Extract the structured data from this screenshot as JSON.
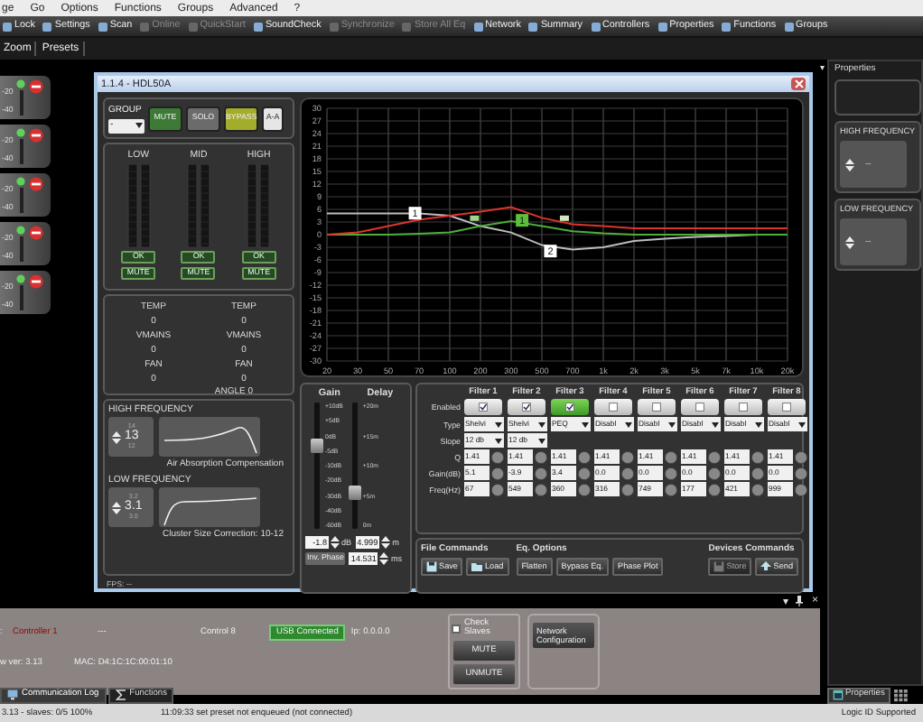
{
  "menu": [
    "ge",
    "Go",
    "Options",
    "Functions",
    "Groups",
    "Advanced",
    "?"
  ],
  "toolbar": [
    {
      "label": "Lock",
      "disabled": false
    },
    {
      "label": "Settings",
      "disabled": false
    },
    {
      "label": "Scan",
      "disabled": false
    },
    {
      "label": "Online",
      "disabled": true
    },
    {
      "label": "QuickStart",
      "disabled": true
    },
    {
      "label": "SoundCheck",
      "disabled": false
    },
    {
      "label": "Synchronize",
      "disabled": true
    },
    {
      "label": "Store All Eq",
      "disabled": true
    },
    {
      "label": "Network",
      "disabled": false
    },
    {
      "label": "Summary",
      "disabled": false
    },
    {
      "label": "Controllers",
      "disabled": false
    },
    {
      "label": "Properties",
      "disabled": false
    },
    {
      "label": "Functions",
      "disabled": false
    },
    {
      "label": "Groups",
      "disabled": false
    }
  ],
  "toolbar2": [
    "Zoom",
    "Presets"
  ],
  "devices": [
    {
      "labels": [
        "-20",
        "-40"
      ]
    },
    {
      "labels": [
        "-20",
        "-40"
      ]
    },
    {
      "labels": [
        "-20",
        "-40"
      ]
    },
    {
      "labels": [
        "-20",
        "-40"
      ]
    },
    {
      "labels": [
        "-20",
        "-40"
      ]
    }
  ],
  "window": {
    "title": "1.1.4 - HDL50A",
    "group": {
      "label": "GROUP",
      "value": "-",
      "buttons": [
        {
          "label": "MUTE",
          "color": "#3d7a36"
        },
        {
          "label": "SOLO",
          "color": "#6b6b6b"
        },
        {
          "label": "BYPASS",
          "color": "#a3ad2c"
        },
        {
          "label": "A-A",
          "color": "#e6e6e6"
        }
      ]
    },
    "bands": [
      {
        "label": "LOW",
        "status": "OK",
        "mute": "MUTE"
      },
      {
        "label": "MID",
        "status": "OK",
        "mute": "MUTE"
      },
      {
        "label": "HIGH",
        "status": "OK",
        "mute": "MUTE"
      }
    ],
    "status_columns": [
      [
        {
          "label": "TEMP",
          "value": "0"
        },
        {
          "label": "VMAINS",
          "value": "0"
        },
        {
          "label": "FAN",
          "value": "0"
        }
      ],
      [
        {
          "label": "TEMP",
          "value": "0"
        },
        {
          "label": "VMAINS",
          "value": "0"
        },
        {
          "label": "FAN",
          "value": "0"
        }
      ]
    ],
    "angle": "ANGLE 0",
    "corrections": [
      {
        "kind": "air",
        "title": "HIGH FREQUENCY",
        "above": "14",
        "value": "13",
        "below": "12",
        "caption": "Air Absorption Compensation"
      },
      {
        "kind": "cluster",
        "title": "LOW FREQUENCY",
        "above": "3.2",
        "value": "3.1",
        "below": "3.0",
        "caption": "Cluster Size Correction:  10-12"
      }
    ],
    "fps": "FPS: --",
    "graph": {
      "chart_data": {
        "type": "line",
        "categories": [
          "20",
          "30",
          "50",
          "70",
          "100",
          "200",
          "300",
          "500",
          "700",
          "1k",
          "2k",
          "3k",
          "5k",
          "7k",
          "10k",
          "20k"
        ],
        "ylim": [
          -30,
          30
        ],
        "grid": true,
        "yticks": [
          30,
          27,
          24,
          21,
          18,
          15,
          12,
          9,
          6,
          3,
          0,
          -3,
          -6,
          -9,
          -12,
          -15,
          -18,
          -21,
          -24,
          -27,
          -30
        ],
        "series": [
          {
            "color": "#bdbdbd",
            "values": [
              5,
              5,
              5,
              5,
              4.5,
              2,
              0.5,
              -2.5,
              -3.5,
              -3,
              -1.5,
              -1,
              -0.5,
              -0.3,
              0,
              0
            ]
          },
          {
            "color": "#4caf3a",
            "values": [
              0,
              0,
              0,
              0.2,
              0.5,
              2,
              3.2,
              2,
              0.8,
              0.3,
              0,
              0,
              0,
              0,
              0,
              0
            ]
          },
          {
            "color": "#e0342c",
            "values": [
              0,
              0.5,
              2,
              3.5,
              4.5,
              5.5,
              6.5,
              4,
              2.5,
              2,
              1.5,
              1.5,
              1.5,
              1.5,
              1.5,
              1.5
            ]
          }
        ],
        "annotations": [
          "1",
          "1",
          "2"
        ]
      }
    },
    "gain_delay": {
      "gain_label": "Gain",
      "delay_label": "Delay",
      "gain_scale": [
        "+10dB",
        "+5dB",
        "0dB",
        "-5dB",
        "-10dB",
        "-20dB",
        "-30dB",
        "-40dB",
        "-60dB"
      ],
      "delay_scale": [
        "+20m",
        "+15m",
        "+10m",
        "+5m",
        "0m"
      ],
      "gain_slider": {
        "level": 0.68
      },
      "delay_slider": {
        "level": 0.26
      },
      "gain_value": "-1.8",
      "gain_unit": "dB",
      "delay_value": "4.999",
      "delay_unit": "m",
      "phase_button": "Inv. Phase",
      "time_value": "14.531",
      "time_unit": "ms"
    },
    "row_labels": [
      "Enabled",
      "Type",
      "Slope",
      "Q",
      "Gain(dB)",
      "Freq(Hz)"
    ],
    "filters": [
      {
        "label": "Filter 1",
        "enabled": true,
        "selected": false,
        "type": "Shelvi",
        "slope": "12 db",
        "q": "1.41",
        "gain": "5.1",
        "freq": "67"
      },
      {
        "label": "Filter 2",
        "enabled": true,
        "selected": false,
        "type": "Shelvi",
        "slope": "12 db",
        "q": "1.41",
        "gain": "-3.9",
        "freq": "549"
      },
      {
        "label": "Filter 3",
        "enabled": true,
        "selected": true,
        "type": "PEQ",
        "q": "1.41",
        "gain": "3.4",
        "freq": "360"
      },
      {
        "label": "Filter 4",
        "enabled": false,
        "selected": false,
        "type": "Disabl",
        "q": "1.41",
        "gain": "0.0",
        "freq": "316"
      },
      {
        "label": "Filter 5",
        "enabled": false,
        "selected": false,
        "type": "Disabl",
        "q": "1.41",
        "gain": "0.0",
        "freq": "749"
      },
      {
        "label": "Filter 6",
        "enabled": false,
        "selected": false,
        "type": "Disabl",
        "q": "1.41",
        "gain": "0.0",
        "freq": "177"
      },
      {
        "label": "Filter 7",
        "enabled": false,
        "selected": false,
        "type": "Disabl",
        "q": "1.41",
        "gain": "0.0",
        "freq": "421"
      },
      {
        "label": "Filter 8",
        "enabled": false,
        "selected": false,
        "type": "Disabl",
        "q": "1.41",
        "gain": "0.0",
        "freq": "999"
      }
    ],
    "commands": [
      {
        "title": "File Commands",
        "buttons": [
          {
            "label": "Save",
            "disabled": false
          },
          {
            "label": "Load",
            "disabled": false
          }
        ]
      },
      {
        "title": "Eq. Options",
        "buttons": [
          {
            "label": "Flatten",
            "disabled": false
          },
          {
            "label": "Bypass Eq.",
            "disabled": false
          },
          {
            "label": "Phase Plot",
            "disabled": false
          }
        ]
      },
      {
        "title": "Devices Commands",
        "buttons": [
          {
            "label": "Store",
            "disabled": true
          },
          {
            "label": "Send",
            "disabled": false
          }
        ]
      }
    ]
  },
  "properties": {
    "glyph": "▾",
    "title": "Properties",
    "groups": [
      {
        "title": "HIGH FREQUENCY",
        "value": "--"
      },
      {
        "title": "LOW FREQUENCY",
        "value": "--"
      }
    ],
    "tab": "Properties"
  },
  "dock": {
    "controls": [
      "▾",
      "×"
    ],
    "prefix": ":",
    "controller": "Controller 1",
    "dash": "---",
    "control": "Control 8",
    "usb": "USB Connected",
    "ip": "Ip: 0.0.0.0",
    "fw": "w ver: 3.13",
    "mac": "MAC: D4:1C:1C:00:01:10",
    "check_slaves": {
      "label": "Check Slaves",
      "checked": false
    },
    "slave_buttons": [
      "MUTE",
      "UNMUTE"
    ],
    "network": "Network Configuration"
  },
  "tabs": [
    {
      "label": "Communication Log",
      "selected": true
    },
    {
      "label": "Functions",
      "selected": false
    }
  ],
  "status_bar": [
    "3.13 - slaves: 0/5 100%",
    "11:09:33 set preset not enqueued (not connected)",
    "Logic ID Supported"
  ]
}
